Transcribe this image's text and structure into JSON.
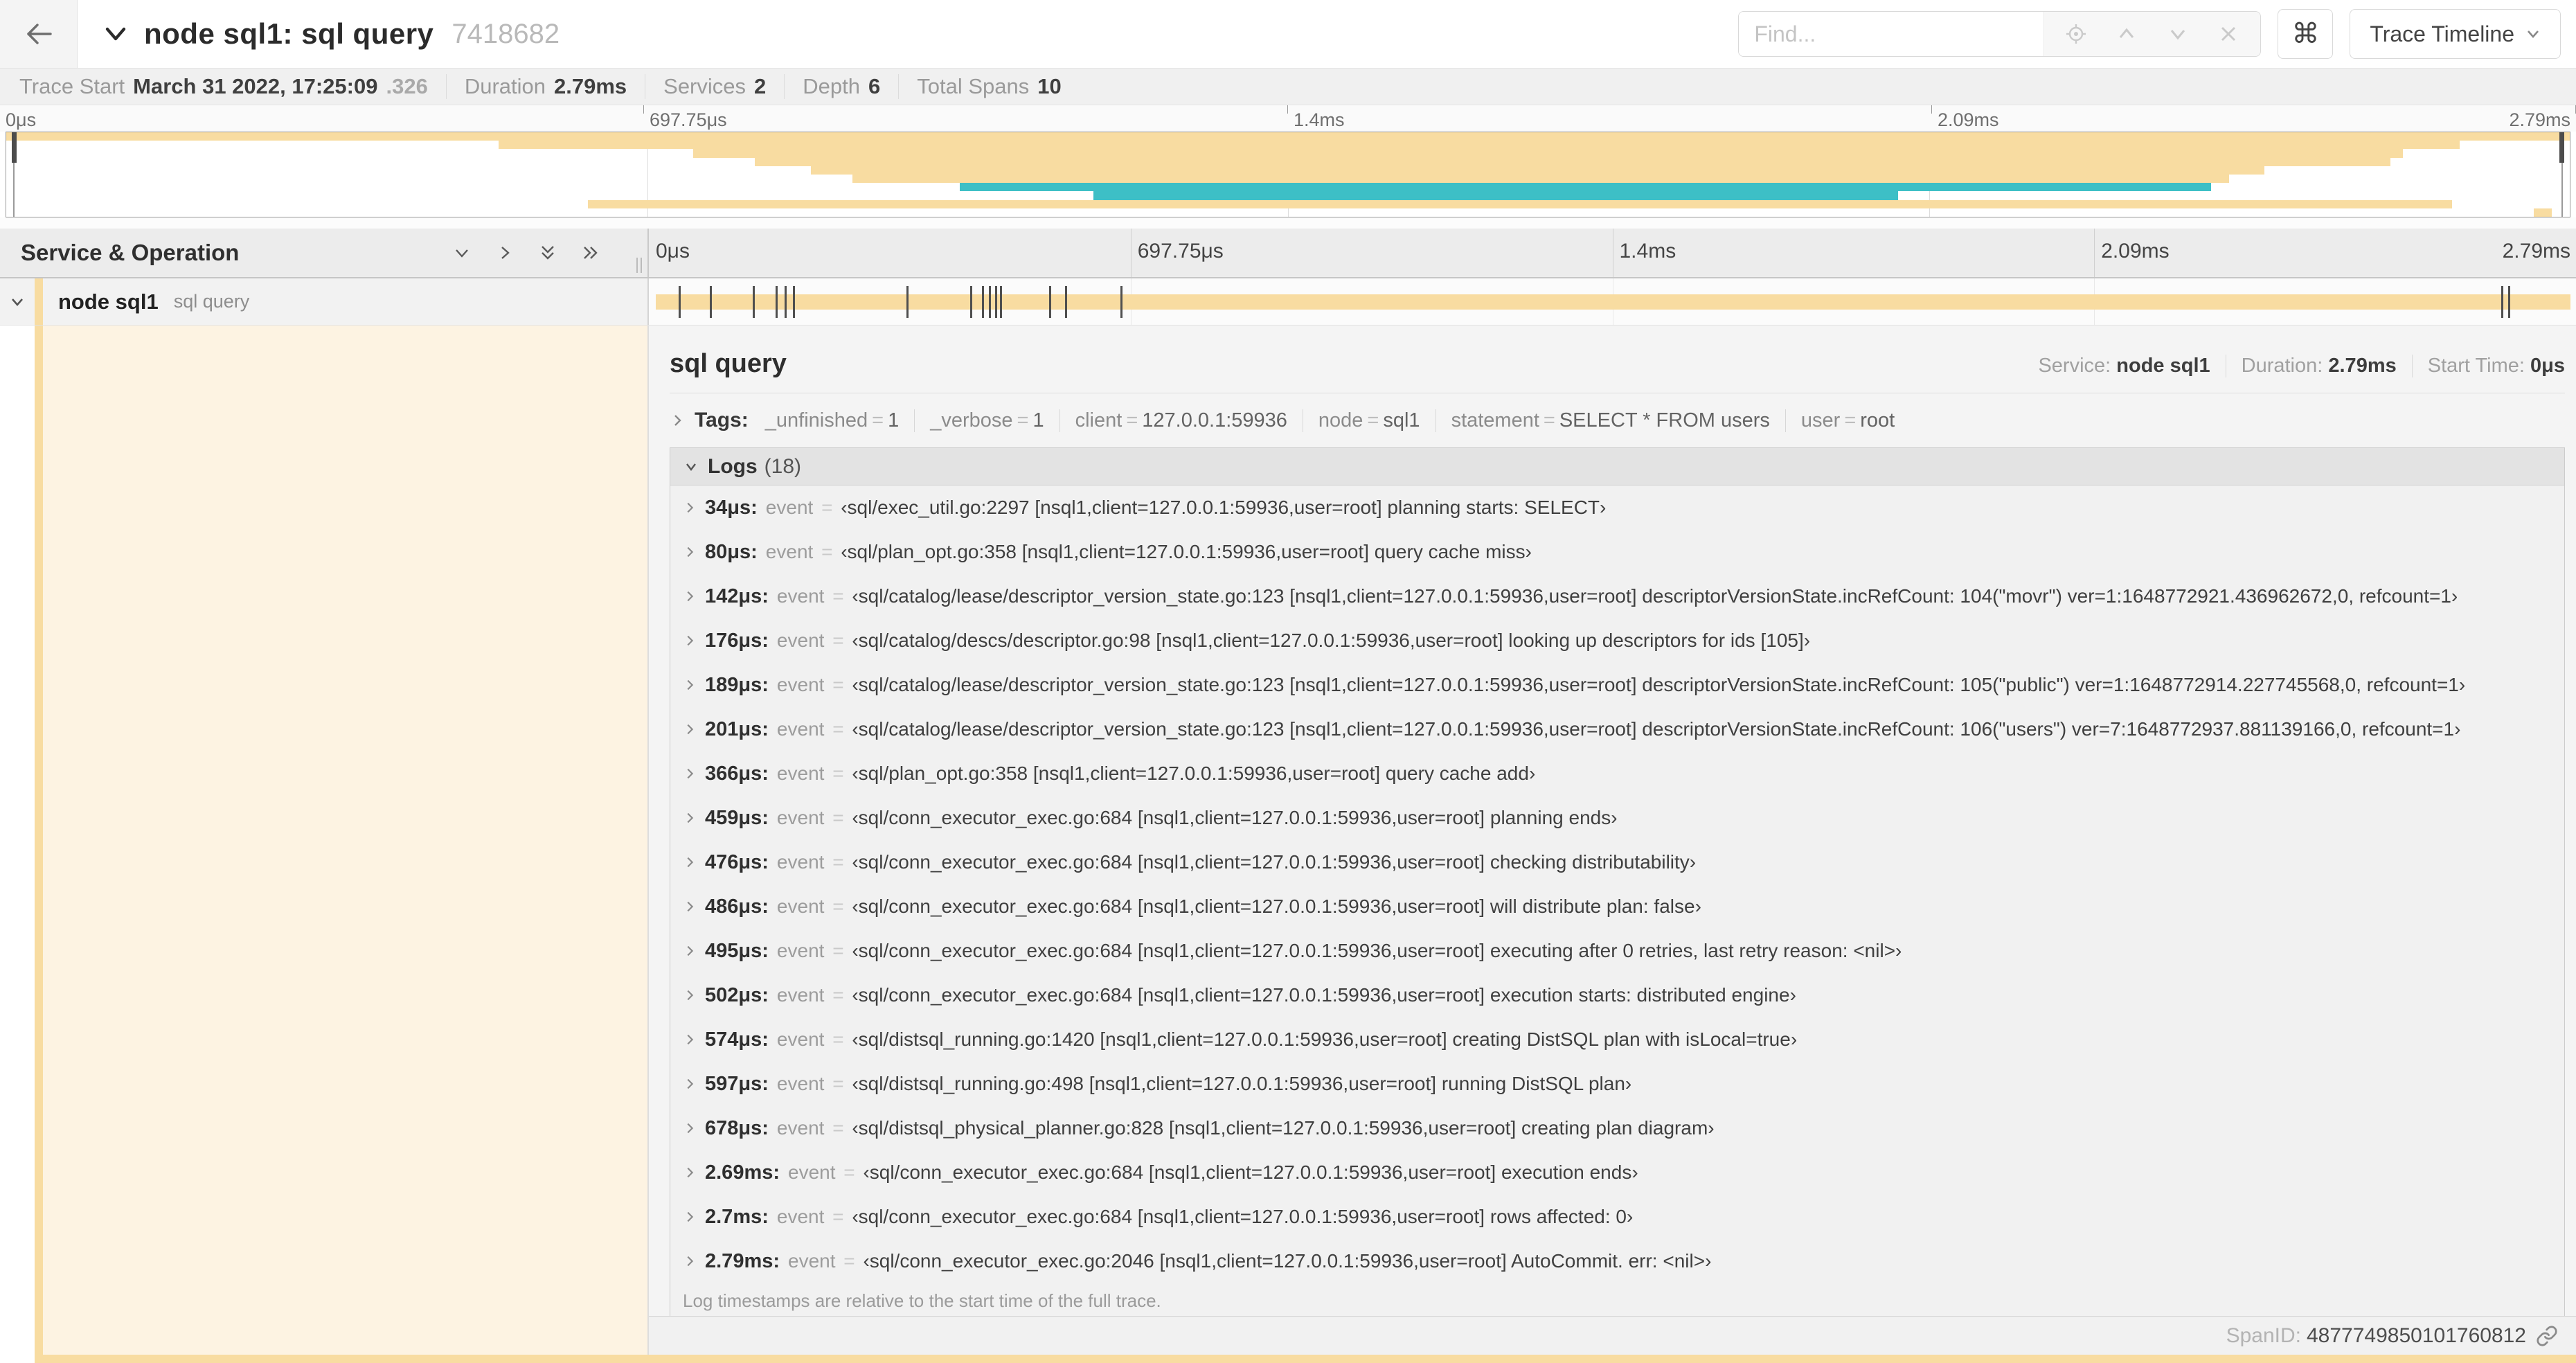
{
  "colors": {
    "tan": "#F8DCA1",
    "teal": "#3DBFC6",
    "cream": "#FDF3E2"
  },
  "header": {
    "title": "node sql1: sql query",
    "trace_id": "7418682",
    "find_placeholder": "Find...",
    "shortcut_glyph": "⌘",
    "trace_timeline_label": "Trace Timeline"
  },
  "trace_meta": [
    {
      "label": "Trace Start",
      "value": "March 31 2022, 17:25:09",
      "suffix": ".326"
    },
    {
      "label": "Duration",
      "value": "2.79ms"
    },
    {
      "label": "Services",
      "value": "2"
    },
    {
      "label": "Depth",
      "value": "6"
    },
    {
      "label": "Total Spans",
      "value": "10"
    }
  ],
  "ruler": {
    "ticks": [
      {
        "label": "0μs",
        "pos": 0
      },
      {
        "label": "697.75μs",
        "pos": 25
      },
      {
        "label": "1.4ms",
        "pos": 50
      },
      {
        "label": "2.09ms",
        "pos": 75
      },
      {
        "label": "2.79ms",
        "pos": 100
      }
    ]
  },
  "minimap_rows": [
    {
      "start": 0.0,
      "end": 1.0,
      "color": "tan"
    },
    {
      "start": 0.192,
      "end": 0.957,
      "color": "tan"
    },
    {
      "start": 0.268,
      "end": 0.935,
      "color": "tan"
    },
    {
      "start": 0.292,
      "end": 0.93,
      "color": "tan"
    },
    {
      "start": 0.314,
      "end": 0.881,
      "color": "tan"
    },
    {
      "start": 0.33,
      "end": 0.867,
      "color": "tan"
    },
    {
      "start": 0.372,
      "end": 0.86,
      "color": "teal"
    },
    {
      "start": 0.424,
      "end": 0.738,
      "color": "teal"
    },
    {
      "start": 0.227,
      "end": 0.954,
      "color": "tan"
    },
    {
      "start": 0.986,
      "end": 0.993,
      "color": "tan"
    }
  ],
  "timeline": {
    "left_title": "Service & Operation"
  },
  "span": {
    "service": "node sql1",
    "operation": "sql query",
    "total_us": 2790,
    "tick_times_us": [
      34,
      80,
      142,
      176,
      189,
      201,
      366,
      459,
      476,
      486,
      495,
      502,
      574,
      597,
      678,
      2690,
      2700
    ]
  },
  "detail": {
    "title": "sql query",
    "meta": [
      {
        "label": "Service:",
        "value": "node sql1"
      },
      {
        "label": "Duration:",
        "value": "2.79ms"
      },
      {
        "label": "Start Time:",
        "value": "0μs"
      }
    ],
    "tags_label": "Tags:",
    "tags": [
      {
        "key": "_unfinished",
        "value": "1"
      },
      {
        "key": "_verbose",
        "value": "1"
      },
      {
        "key": "client",
        "value": "127.0.0.1:59936"
      },
      {
        "key": "node",
        "value": "sql1"
      },
      {
        "key": "statement",
        "value": "SELECT * FROM users"
      },
      {
        "key": "user",
        "value": "root"
      }
    ],
    "logs_label": "Logs",
    "logs_count": "(18)",
    "logs": [
      {
        "time": "34μs:",
        "key": "event",
        "value": "‹sql/exec_util.go:2297 [nsql1,client=127.0.0.1:59936,user=root] planning starts: SELECT›"
      },
      {
        "time": "80μs:",
        "key": "event",
        "value": "‹sql/plan_opt.go:358 [nsql1,client=127.0.0.1:59936,user=root] query cache miss›"
      },
      {
        "time": "142μs:",
        "key": "event",
        "value": "‹sql/catalog/lease/descriptor_version_state.go:123 [nsql1,client=127.0.0.1:59936,user=root] descriptorVersionState.incRefCount: 104(\"movr\") ver=1:1648772921.436962672,0, refcount=1›"
      },
      {
        "time": "176μs:",
        "key": "event",
        "value": "‹sql/catalog/descs/descriptor.go:98 [nsql1,client=127.0.0.1:59936,user=root] looking up descriptors for ids [105]›"
      },
      {
        "time": "189μs:",
        "key": "event",
        "value": "‹sql/catalog/lease/descriptor_version_state.go:123 [nsql1,client=127.0.0.1:59936,user=root] descriptorVersionState.incRefCount: 105(\"public\") ver=1:1648772914.227745568,0, refcount=1›"
      },
      {
        "time": "201μs:",
        "key": "event",
        "value": "‹sql/catalog/lease/descriptor_version_state.go:123 [nsql1,client=127.0.0.1:59936,user=root] descriptorVersionState.incRefCount: 106(\"users\") ver=7:1648772937.881139166,0, refcount=1›"
      },
      {
        "time": "366μs:",
        "key": "event",
        "value": "‹sql/plan_opt.go:358 [nsql1,client=127.0.0.1:59936,user=root] query cache add›"
      },
      {
        "time": "459μs:",
        "key": "event",
        "value": "‹sql/conn_executor_exec.go:684 [nsql1,client=127.0.0.1:59936,user=root] planning ends›"
      },
      {
        "time": "476μs:",
        "key": "event",
        "value": "‹sql/conn_executor_exec.go:684 [nsql1,client=127.0.0.1:59936,user=root] checking distributability›"
      },
      {
        "time": "486μs:",
        "key": "event",
        "value": "‹sql/conn_executor_exec.go:684 [nsql1,client=127.0.0.1:59936,user=root] will distribute plan: false›"
      },
      {
        "time": "495μs:",
        "key": "event",
        "value": "‹sql/conn_executor_exec.go:684 [nsql1,client=127.0.0.1:59936,user=root] executing after 0 retries, last retry reason: <nil>›"
      },
      {
        "time": "502μs:",
        "key": "event",
        "value": "‹sql/conn_executor_exec.go:684 [nsql1,client=127.0.0.1:59936,user=root] execution starts: distributed engine›"
      },
      {
        "time": "574μs:",
        "key": "event",
        "value": "‹sql/distsql_running.go:1420 [nsql1,client=127.0.0.1:59936,user=root] creating DistSQL plan with isLocal=true›"
      },
      {
        "time": "597μs:",
        "key": "event",
        "value": "‹sql/distsql_running.go:498 [nsql1,client=127.0.0.1:59936,user=root] running DistSQL plan›"
      },
      {
        "time": "678μs:",
        "key": "event",
        "value": "‹sql/distsql_physical_planner.go:828 [nsql1,client=127.0.0.1:59936,user=root] creating plan diagram›"
      },
      {
        "time": "2.69ms:",
        "key": "event",
        "value": "‹sql/conn_executor_exec.go:684 [nsql1,client=127.0.0.1:59936,user=root] execution ends›"
      },
      {
        "time": "2.7ms:",
        "key": "event",
        "value": "‹sql/conn_executor_exec.go:684 [nsql1,client=127.0.0.1:59936,user=root] rows affected: 0›"
      },
      {
        "time": "2.79ms:",
        "key": "event",
        "value": "‹sql/conn_executor_exec.go:2046 [nsql1,client=127.0.0.1:59936,user=root] AutoCommit. err: <nil>›"
      }
    ],
    "footnote": "Log timestamps are relative to the start time of the full trace.",
    "span_id_label": "SpanID:",
    "span_id": "4877749850101760812"
  }
}
